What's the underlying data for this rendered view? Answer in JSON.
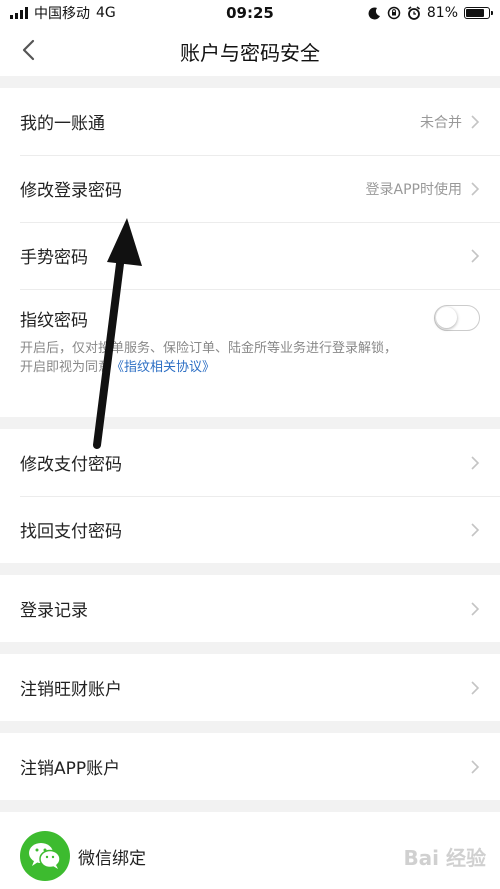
{
  "status": {
    "carrier": "中国移动",
    "network": "4G",
    "time": "09:25",
    "battery_text": "81%",
    "battery_level": 0.81
  },
  "nav": {
    "title": "账户与密码安全"
  },
  "groups": {
    "account": {
      "yizhangtong": {
        "label": "我的一账通",
        "value": "未合并"
      },
      "login_password": {
        "label": "修改登录密码",
        "value": "登录APP时使用"
      },
      "gesture_password": {
        "label": "手势密码"
      },
      "fingerprint": {
        "label": "指纹密码",
        "desc_text": "开启后，仅对投单服务、保险订单、陆金所等业务进行登录解锁，开启即视为同意",
        "desc_link": "《指纹相关协议》",
        "enabled": false
      }
    },
    "payment": {
      "change_pay_password": {
        "label": "修改支付密码"
      },
      "recover_pay_password": {
        "label": "找回支付密码"
      }
    },
    "login_record": {
      "label": "登录记录"
    },
    "cancel_wangcai": {
      "label": "注销旺财账户"
    },
    "cancel_app": {
      "label": "注销APP账户"
    },
    "wechat": {
      "label": "微信绑定"
    }
  },
  "watermark": "Bai 经验",
  "colors": {
    "link": "#2d6fc4",
    "wechat_green": "#3dbb2f",
    "background": "#f2f2f2"
  }
}
